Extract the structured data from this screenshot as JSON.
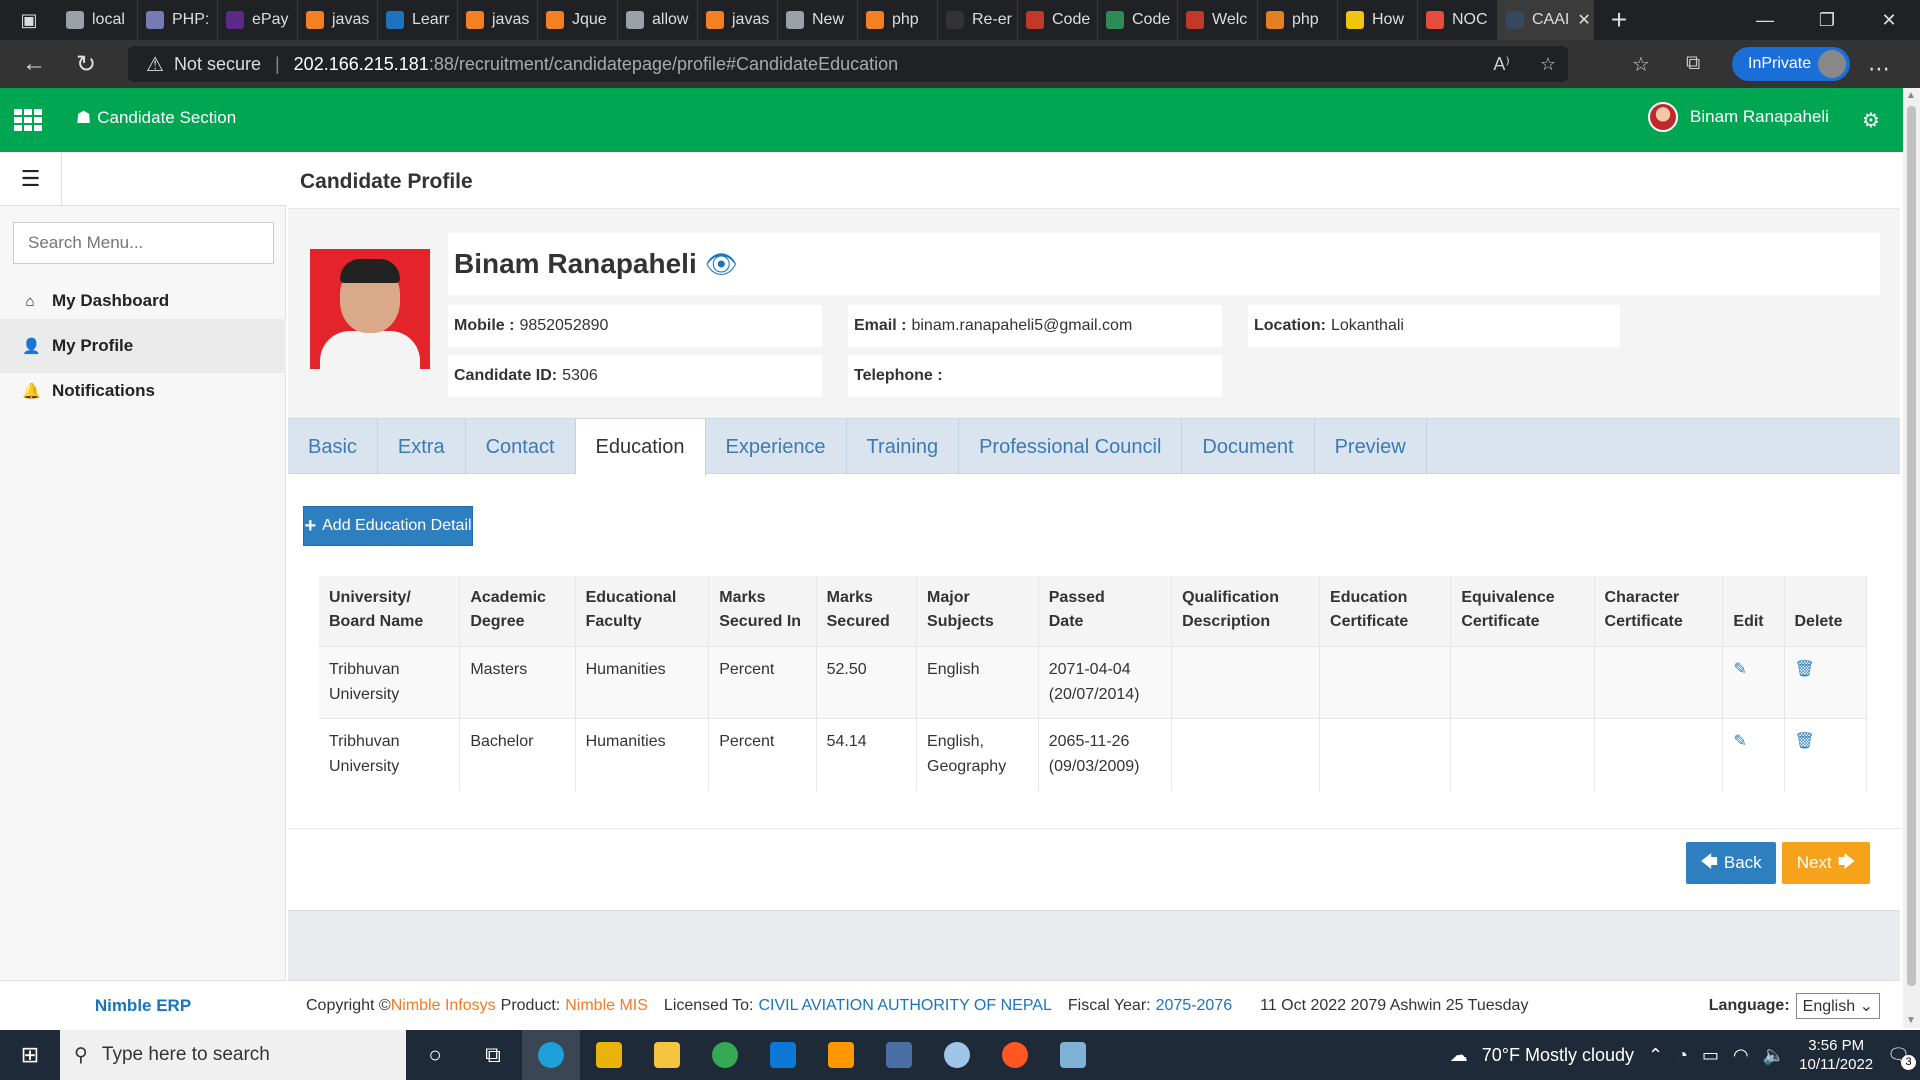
{
  "browser": {
    "tabs": [
      {
        "label": "local",
        "color": "#9aa0a6"
      },
      {
        "label": "PHP:",
        "color": "#777bb3"
      },
      {
        "label": "ePay",
        "color": "#5b2a86"
      },
      {
        "label": "javas",
        "color": "#f48024"
      },
      {
        "label": "Learr",
        "color": "#1e73be"
      },
      {
        "label": "javas",
        "color": "#f48024"
      },
      {
        "label": "Jque",
        "color": "#f48024"
      },
      {
        "label": "allow",
        "color": "#9aa0a6"
      },
      {
        "label": "javas",
        "color": "#f48024"
      },
      {
        "label": "New",
        "color": "#9aa0a6"
      },
      {
        "label": "php",
        "color": "#f48024"
      },
      {
        "label": "Re-er",
        "color": "#333333"
      },
      {
        "label": "Code",
        "color": "#c0392b"
      },
      {
        "label": "Code",
        "color": "#2e8b57"
      },
      {
        "label": "Welc",
        "color": "#c0392b"
      },
      {
        "label": "php",
        "color": "#e67e22"
      },
      {
        "label": "How",
        "color": "#f1c40f"
      },
      {
        "label": "NOC",
        "color": "#e74c3c"
      },
      {
        "label": "CAAI",
        "color": "#34495e"
      }
    ],
    "url_host": "202.166.215.181",
    "url_path": ":88/recruitment/candidatepage/profile#CandidateEducation",
    "not_secure": "Not secure",
    "inprivate": "InPrivate"
  },
  "header": {
    "section_title": "Candidate Section",
    "user_name": "Binam Ranapaheli",
    "bg_color": "#00a651"
  },
  "sidebar": {
    "search_placeholder": "Search Menu...",
    "items": [
      {
        "label": "My Dashboard",
        "icon": "home-icon"
      },
      {
        "label": "My Profile",
        "icon": "user-icon"
      },
      {
        "label": "Notifications",
        "icon": "bell-icon"
      }
    ],
    "footer": "Nimble ERP"
  },
  "profile": {
    "page_title": "Candidate Profile",
    "name": "Binam Ranapaheli",
    "mobile_label": "Mobile :",
    "mobile": "9852052890",
    "email_label": "Email :",
    "email": "binam.ranapaheli5@gmail.com",
    "location_label": "Location:",
    "location": "Lokanthali",
    "candidate_id_label": "Candidate ID:",
    "candidate_id": "5306",
    "telephone_label": "Telephone :",
    "telephone": ""
  },
  "tabs": [
    "Basic",
    "Extra",
    "Contact",
    "Education",
    "Experience",
    "Training",
    "Professional Council",
    "Document",
    "Preview"
  ],
  "active_tab": "Education",
  "education": {
    "add_button": "Add Education Detail",
    "columns": [
      [
        "University/",
        "Board Name"
      ],
      [
        "Academic",
        "Degree"
      ],
      [
        "Educational",
        "Faculty"
      ],
      [
        "Marks",
        "Secured In"
      ],
      [
        "Marks",
        "Secured"
      ],
      [
        "Major",
        "Subjects"
      ],
      [
        "Passed",
        "Date"
      ],
      [
        "Qualification",
        "Description"
      ],
      [
        "Education",
        "Certificate"
      ],
      [
        "Equivalence",
        "Certificate"
      ],
      [
        "Character",
        "Certificate"
      ],
      [
        "",
        "Edit"
      ],
      [
        "",
        "Delete"
      ]
    ],
    "rows": [
      {
        "university": [
          "Tribhuvan",
          "University"
        ],
        "degree": "Masters",
        "faculty": "Humanities",
        "marks_in": "Percent",
        "marks": "52.50",
        "subjects": [
          "English"
        ],
        "passed": [
          "2071-04-04",
          "(20/07/2014)"
        ],
        "description": "",
        "edu_cert": "",
        "equiv_cert": "",
        "char_cert": ""
      },
      {
        "university": [
          "Tribhuvan",
          "University"
        ],
        "degree": "Bachelor",
        "faculty": "Humanities",
        "marks_in": "Percent",
        "marks": "54.14",
        "subjects": [
          "English,",
          "Geography"
        ],
        "passed": [
          "2065-11-26",
          "(09/03/2009)"
        ],
        "description": "",
        "edu_cert": "",
        "equiv_cert": "",
        "char_cert": ""
      }
    ],
    "back_button": "Back",
    "next_button": "Next"
  },
  "footer": {
    "copyright": "Copyright ©",
    "company": "Nimble Infosys",
    "product_label": "Product:",
    "product": "Nimble MIS",
    "licensed_label": "Licensed To:",
    "licensed_to": "CIVIL AVIATION AUTHORITY OF NEPAL",
    "fiscal_label": "Fiscal Year:",
    "fiscal_year": "2075-2076",
    "date_text": "11 Oct 2022 2079 Ashwin 25 Tuesday",
    "language_label": "Language:",
    "language": "English"
  },
  "taskbar": {
    "search_placeholder": "Type here to search",
    "weather": "70°F  Mostly cloudy",
    "time": "3:56 PM",
    "date": "10/11/2022",
    "notification_count": "3"
  }
}
